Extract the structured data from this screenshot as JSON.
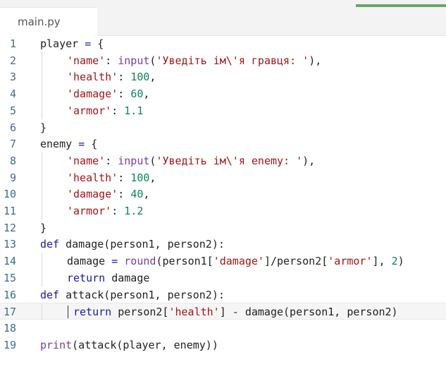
{
  "tab": {
    "filename": "main.py"
  },
  "editor": {
    "active_line": 17,
    "lines": [
      {
        "n": "1",
        "indent": 0,
        "tokens": [
          {
            "t": "player",
            "c": "pl"
          },
          {
            "t": " = ",
            "c": "op"
          },
          {
            "t": "{",
            "c": "pl"
          }
        ]
      },
      {
        "n": "2",
        "indent": 1,
        "tokens": [
          {
            "t": "'name'",
            "c": "str"
          },
          {
            "t": ": ",
            "c": "pl"
          },
          {
            "t": "input",
            "c": "fn"
          },
          {
            "t": "(",
            "c": "pl"
          },
          {
            "t": "'Уведіть ім\\'я гравця: '",
            "c": "str"
          },
          {
            "t": "),",
            "c": "pl"
          }
        ]
      },
      {
        "n": "3",
        "indent": 1,
        "tokens": [
          {
            "t": "'health'",
            "c": "str"
          },
          {
            "t": ": ",
            "c": "pl"
          },
          {
            "t": "100",
            "c": "num"
          },
          {
            "t": ",",
            "c": "pl"
          }
        ]
      },
      {
        "n": "4",
        "indent": 1,
        "tokens": [
          {
            "t": "'damage'",
            "c": "str"
          },
          {
            "t": ": ",
            "c": "pl"
          },
          {
            "t": "60",
            "c": "num"
          },
          {
            "t": ",",
            "c": "pl"
          }
        ]
      },
      {
        "n": "5",
        "indent": 1,
        "tokens": [
          {
            "t": "'armor'",
            "c": "str"
          },
          {
            "t": ": ",
            "c": "pl"
          },
          {
            "t": "1.1",
            "c": "num"
          }
        ]
      },
      {
        "n": "6",
        "indent": 0,
        "tokens": [
          {
            "t": "}",
            "c": "pl"
          }
        ]
      },
      {
        "n": "7",
        "indent": 0,
        "tokens": [
          {
            "t": "enemy",
            "c": "pl"
          },
          {
            "t": " = ",
            "c": "op"
          },
          {
            "t": "{",
            "c": "pl"
          }
        ]
      },
      {
        "n": "8",
        "indent": 1,
        "tokens": [
          {
            "t": "'name'",
            "c": "str"
          },
          {
            "t": ": ",
            "c": "pl"
          },
          {
            "t": "input",
            "c": "fn"
          },
          {
            "t": "(",
            "c": "pl"
          },
          {
            "t": "'Уведіть ім\\'я enemy: '",
            "c": "str"
          },
          {
            "t": "),",
            "c": "pl"
          }
        ]
      },
      {
        "n": "9",
        "indent": 1,
        "tokens": [
          {
            "t": "'health'",
            "c": "str"
          },
          {
            "t": ": ",
            "c": "pl"
          },
          {
            "t": "100",
            "c": "num"
          },
          {
            "t": ",",
            "c": "pl"
          }
        ]
      },
      {
        "n": "10",
        "indent": 1,
        "tokens": [
          {
            "t": "'damage'",
            "c": "str"
          },
          {
            "t": ": ",
            "c": "pl"
          },
          {
            "t": "40",
            "c": "num"
          },
          {
            "t": ",",
            "c": "pl"
          }
        ]
      },
      {
        "n": "11",
        "indent": 1,
        "tokens": [
          {
            "t": "'armor'",
            "c": "str"
          },
          {
            "t": ": ",
            "c": "pl"
          },
          {
            "t": "1.2",
            "c": "num"
          }
        ]
      },
      {
        "n": "12",
        "indent": 0,
        "tokens": [
          {
            "t": "}",
            "c": "pl"
          }
        ]
      },
      {
        "n": "13",
        "indent": 0,
        "tokens": [
          {
            "t": "def",
            "c": "kw"
          },
          {
            "t": " damage(person1, person2):",
            "c": "pl"
          }
        ]
      },
      {
        "n": "14",
        "indent": 1,
        "tokens": [
          {
            "t": "damage",
            "c": "pl"
          },
          {
            "t": " = ",
            "c": "op"
          },
          {
            "t": "round",
            "c": "fn"
          },
          {
            "t": "(person1[",
            "c": "pl"
          },
          {
            "t": "'damage'",
            "c": "str"
          },
          {
            "t": "]/person2[",
            "c": "pl"
          },
          {
            "t": "'armor'",
            "c": "str"
          },
          {
            "t": "], ",
            "c": "pl"
          },
          {
            "t": "2",
            "c": "num"
          },
          {
            "t": ")",
            "c": "pl"
          }
        ]
      },
      {
        "n": "15",
        "indent": 1,
        "tokens": [
          {
            "t": "return",
            "c": "kw"
          },
          {
            "t": " damage",
            "c": "pl"
          }
        ]
      },
      {
        "n": "16",
        "indent": 0,
        "tokens": [
          {
            "t": "def",
            "c": "kw"
          },
          {
            "t": " attack(person1, person2):",
            "c": "pl"
          }
        ]
      },
      {
        "n": "17",
        "indent": 1.25,
        "tokens": [
          {
            "t": "return",
            "c": "kw"
          },
          {
            "t": " person2[",
            "c": "pl"
          },
          {
            "t": "'health'",
            "c": "str"
          },
          {
            "t": "] ",
            "c": "pl"
          },
          {
            "t": "-",
            "c": "op"
          },
          {
            "t": " damage(person1, person2)",
            "c": "pl"
          }
        ]
      },
      {
        "n": "18",
        "indent": 0,
        "tokens": []
      },
      {
        "n": "19",
        "indent": 0,
        "tokens": [
          {
            "t": "print",
            "c": "fn"
          },
          {
            "t": "(attack(player, enemy))",
            "c": "pl"
          }
        ]
      }
    ]
  }
}
